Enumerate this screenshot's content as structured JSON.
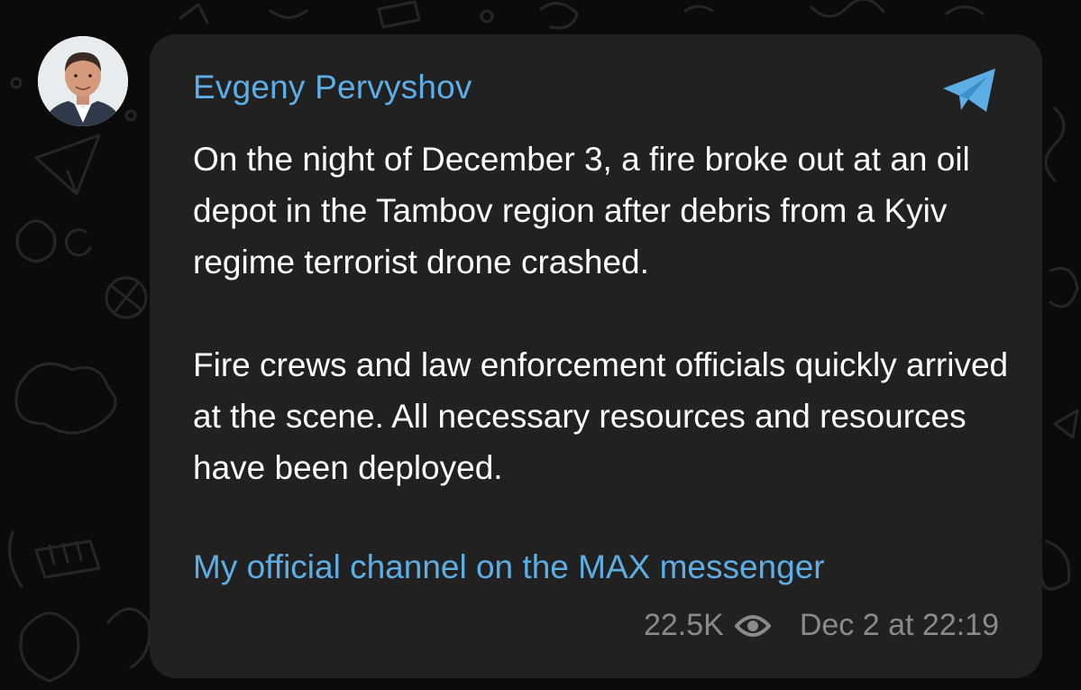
{
  "post": {
    "author": "Evgeny Pervyshov",
    "paragraphs": [
      "On the night of December 3, a fire broke out at an oil depot in the Tambov region after debris from a Kyiv regime terrorist drone crashed.",
      "Fire crews and law enforcement officials quickly arrived at the scene. All necessary resources and resources have been deployed."
    ],
    "link_text": "My official channel on the MAX messenger",
    "views": "22.5K",
    "timestamp": "Dec 2 at 22:19"
  },
  "icons": {
    "channel": "telegram-plane-icon",
    "views": "eye-icon",
    "avatar": "author-avatar-photo"
  },
  "colors": {
    "background": "#0b0b0b",
    "bubble": "#212121",
    "accent": "#5eaee6",
    "text": "#ffffff",
    "meta": "#8a8a8a"
  }
}
